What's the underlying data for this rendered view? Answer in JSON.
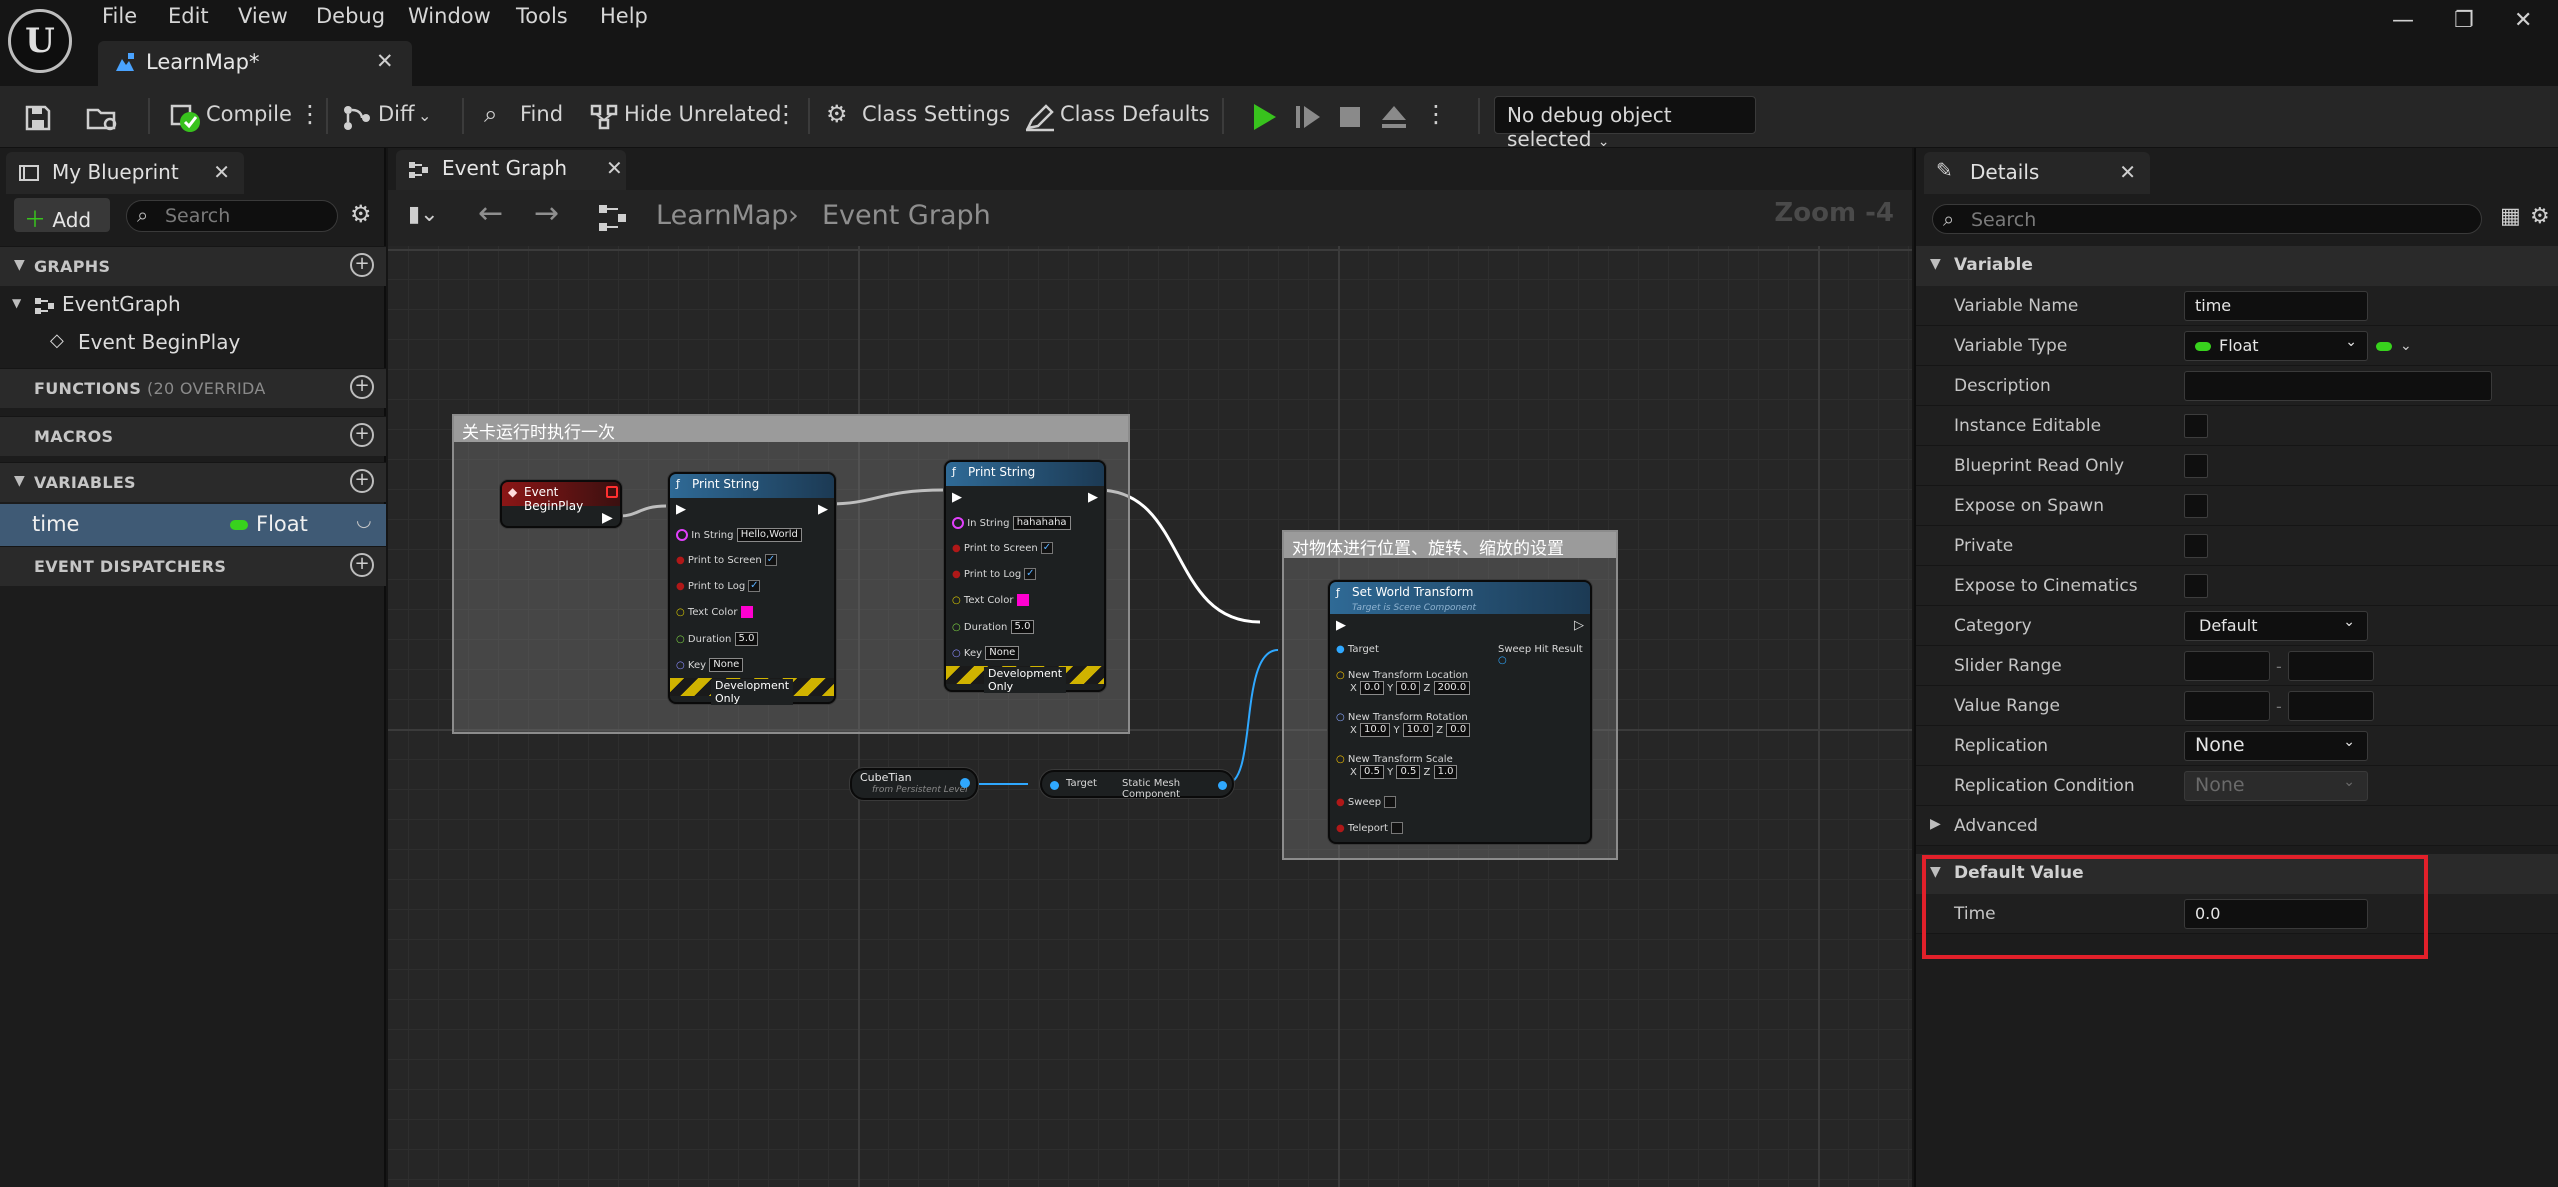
{
  "app": {
    "menu": [
      "File",
      "Edit",
      "View",
      "Debug",
      "Window",
      "Tools",
      "Help"
    ],
    "document_tab": "LearnMap*"
  },
  "toolbar": {
    "compile": "Compile",
    "diff": "Diff",
    "find": "Find",
    "hide_unrelated": "Hide Unrelated",
    "class_settings": "Class Settings",
    "class_defaults": "Class Defaults",
    "debug_object": "No debug object selected"
  },
  "my_blueprint": {
    "tab": "My Blueprint",
    "add_label": "Add",
    "search_placeholder": "Search",
    "sections": {
      "graphs": "GRAPHS",
      "functions": "FUNCTIONS",
      "functions_sub": "(20 OVERRIDA",
      "macros": "MACROS",
      "variables": "VARIABLES",
      "event_dispatchers": "EVENT DISPATCHERS"
    },
    "graph_items": [
      "EventGraph",
      "Event BeginPlay"
    ],
    "variable": {
      "name": "time",
      "type": "Float",
      "type_color": "#38d21d"
    }
  },
  "graph": {
    "tab": "Event Graph",
    "breadcrumb": [
      "LearnMap",
      "Event Graph"
    ],
    "zoom": "Zoom -4",
    "comments": [
      "关卡运行时执行一次",
      "对物体进行位置、旋转、缩放的设置"
    ],
    "event_node": "Event BeginPlay",
    "print1": {
      "title": "Print String",
      "in_string_label": "In String",
      "in_string": "Hello,World",
      "print_to_screen": "Print to Screen",
      "print_to_log": "Print to Log",
      "text_color": "Text Color",
      "duration_label": "Duration",
      "duration": "5.0",
      "key_label": "Key",
      "key": "None",
      "dev_only": "Development Only"
    },
    "print2": {
      "title": "Print String",
      "in_string_label": "In String",
      "in_string": "hahahaha",
      "print_to_screen": "Print to Screen",
      "print_to_log": "Print to Log",
      "text_color": "Text Color",
      "duration_label": "Duration",
      "duration": "5.0",
      "key_label": "Key",
      "key": "None",
      "dev_only": "Development Only"
    },
    "cube_node": {
      "title": "CubeTian",
      "sub": "from Persistent Level"
    },
    "getter_node": {
      "target": "Target",
      "output": "Static Mesh Component"
    },
    "set_transform": {
      "title": "Set World Transform",
      "sub": "Target is Scene Component",
      "target": "Target",
      "sweep_hit": "Sweep Hit Result",
      "loc_label": "New Transform Location",
      "loc": [
        "0.0",
        "0.0",
        "200.0"
      ],
      "rot_label": "New Transform Rotation",
      "rot": [
        "10.0",
        "10.0",
        "0.0"
      ],
      "scale_label": "New Transform Scale",
      "scale": [
        "0.5",
        "0.5",
        "1.0"
      ],
      "sweep": "Sweep",
      "teleport": "Teleport",
      "axis": [
        "X",
        "Y",
        "Z"
      ]
    }
  },
  "details": {
    "tab": "Details",
    "search_placeholder": "Search",
    "variable_section": "Variable",
    "rows": {
      "variable_name": "Variable Name",
      "variable_name_value": "time",
      "variable_type": "Variable Type",
      "variable_type_value": "Float",
      "description": "Description",
      "instance_editable": "Instance Editable",
      "blueprint_read_only": "Blueprint Read Only",
      "expose_on_spawn": "Expose on Spawn",
      "private": "Private",
      "expose_to_cinematics": "Expose to Cinematics",
      "category": "Category",
      "category_value": "Default",
      "slider_range": "Slider Range",
      "value_range": "Value Range",
      "replication": "Replication",
      "replication_value": "None",
      "replication_condition": "Replication Condition",
      "replication_condition_value": "None"
    },
    "advanced": "Advanced",
    "default_value_section": "Default Value",
    "time_label": "Time",
    "time_value": "0.0",
    "highlight_color": "#e2202a"
  }
}
